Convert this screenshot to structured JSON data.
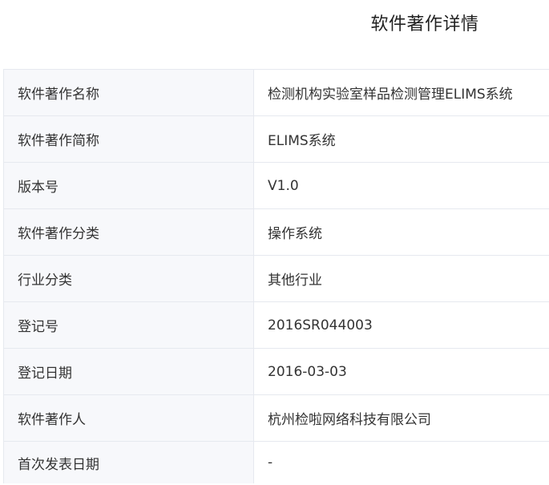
{
  "title": "软件著作详情",
  "rows": [
    {
      "label": "软件著作名称",
      "value": "检测机构实验室样品检测管理ELIMS系统"
    },
    {
      "label": "软件著作简称",
      "value": "ELIMS系统"
    },
    {
      "label": "版本号",
      "value": "V1.0"
    },
    {
      "label": "软件著作分类",
      "value": "操作系统"
    },
    {
      "label": "行业分类",
      "value": "其他行业"
    },
    {
      "label": "登记号",
      "value": "2016SR044003"
    },
    {
      "label": "登记日期",
      "value": "2016-03-03"
    },
    {
      "label": "软件著作人",
      "value": "杭州检啦网络科技有限公司"
    },
    {
      "label": "首次发表日期",
      "value": "-"
    }
  ]
}
